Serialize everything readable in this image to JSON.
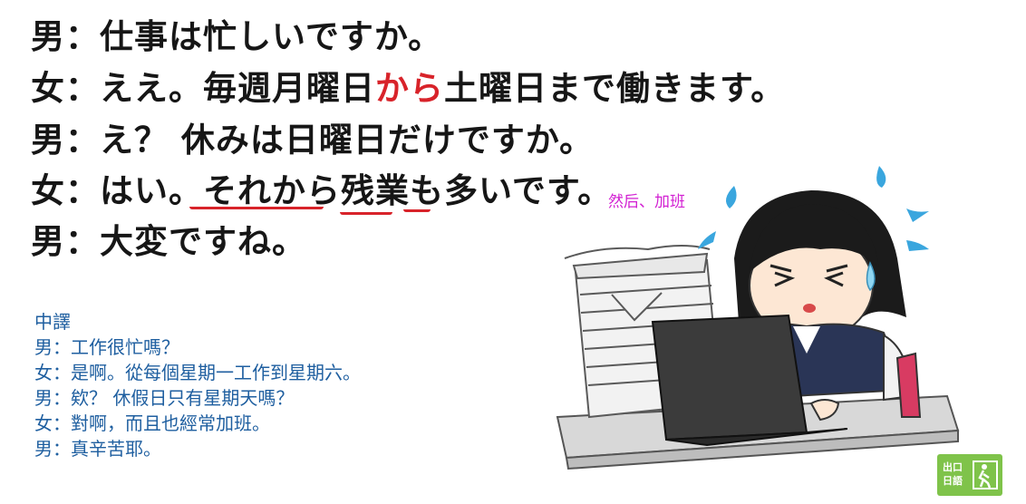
{
  "dialogue_ja": [
    {
      "speaker": "男",
      "colon": "：",
      "parts": [
        {
          "t": "仕事は忙しいですか。",
          "red": false
        }
      ]
    },
    {
      "speaker": "女",
      "colon": "：",
      "parts": [
        {
          "t": "ええ。毎週月曜日",
          "red": false
        },
        {
          "t": "から",
          "red": true
        },
        {
          "t": "土曜日まで働きます。",
          "red": false
        }
      ]
    },
    {
      "speaker": "男",
      "colon": "：",
      "parts": [
        {
          "t": "え？ 休みは日曜日だけですか。",
          "red": false
        }
      ]
    },
    {
      "speaker": "女",
      "colon": "：",
      "parts": [
        {
          "t": "はい。",
          "red": false
        },
        {
          "t": "それから",
          "red": false
        },
        {
          "t": "残業",
          "red": false
        },
        {
          "t": "も",
          "red": false
        },
        {
          "t": "多いです。",
          "red": false
        }
      ]
    },
    {
      "speaker": "男",
      "colon": "：",
      "parts": [
        {
          "t": "大変ですね。",
          "red": false
        }
      ]
    }
  ],
  "annotation": "然后、加班",
  "translation": {
    "heading": "中譯",
    "lines": [
      "男：工作很忙嗎？",
      "女：是啊。從每個星期一工作到星期六。",
      "男：欸？ 休假日只有星期天嗎？",
      "女：對啊，而且也經常加班。",
      "男：真辛苦耶。"
    ]
  },
  "logo": {
    "line1": "出口",
    "line2": "日語"
  },
  "illustration": {
    "subject": "stressed office worker at laptop beside paper stack",
    "icon": "overworked-woman-illustration"
  },
  "colors": {
    "accent_red": "#d8232a",
    "annotation_magenta": "#d21fd2",
    "translation_blue": "#1f5fa0",
    "logo_green": "#7fc34a"
  }
}
